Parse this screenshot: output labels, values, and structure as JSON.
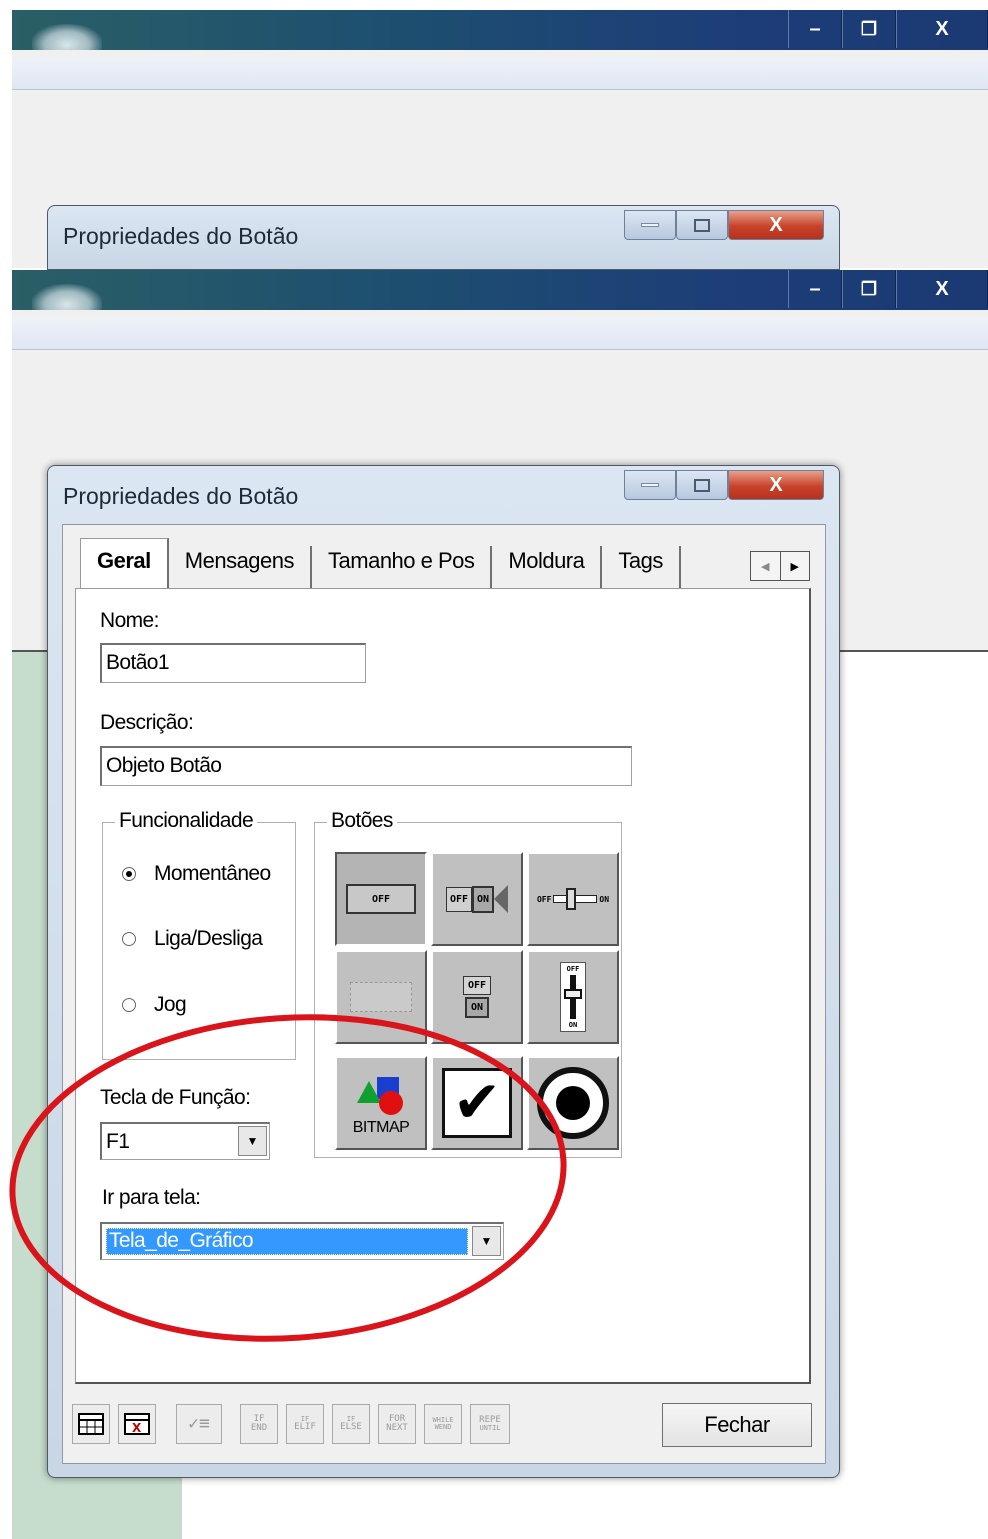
{
  "window_controls": {
    "minimize": "–",
    "maximize": "❐",
    "close": "X"
  },
  "dialog": {
    "title": "Propriedades do Botão",
    "controls": {
      "minimize": "▬",
      "maximize": "▣",
      "close": "X"
    }
  },
  "tabs": [
    {
      "label": "Geral",
      "active": true
    },
    {
      "label": "Mensagens"
    },
    {
      "label": "Tamanho e Pos"
    },
    {
      "label": "Moldura"
    },
    {
      "label": "Tags"
    }
  ],
  "tab_scroll": {
    "left": "◀",
    "right": "▶"
  },
  "form": {
    "name_label": "Nome:",
    "name_value": "Botão1",
    "description_label": "Descrição:",
    "description_value": "Objeto Botão",
    "functionality": {
      "title": "Funcionalidade",
      "options": [
        {
          "label": "Momentâneo",
          "selected": true
        },
        {
          "label": "Liga/Desliga",
          "selected": false
        },
        {
          "label": "Jog",
          "selected": false
        }
      ]
    },
    "buttons_group": {
      "title": "Botões",
      "styles": [
        {
          "icon": "off-push-button-icon",
          "text": "OFF",
          "selected": true
        },
        {
          "icon": "off-on-rocker-icon",
          "text": "OFF ON"
        },
        {
          "icon": "horizontal-slider-switch-icon",
          "text": "OFF ON"
        },
        {
          "icon": "blank-button-icon",
          "text": ""
        },
        {
          "icon": "vertical-rocker-icon",
          "text": "OFF ON"
        },
        {
          "icon": "vertical-slider-switch-icon",
          "text": "OFF ON"
        },
        {
          "icon": "bitmap-shapes-icon",
          "text": "BITMAP"
        },
        {
          "icon": "checkmark-icon",
          "text": ""
        },
        {
          "icon": "radio-target-icon",
          "text": ""
        }
      ]
    },
    "function_key_label": "Tecla de Função:",
    "function_key_value": "F1",
    "go_to_screen_label": "Ir para tela:",
    "go_to_screen_value": "Tela_de_Gráfico"
  },
  "toolbar": {
    "keywords": [
      [
        "IF",
        "END"
      ],
      [
        "IF",
        "ELIF"
      ],
      [
        "IF",
        "ELSE"
      ],
      [
        "FOR",
        "NEXT"
      ],
      [
        "WHILE",
        "WEND"
      ],
      [
        "REPE",
        "UNTIL"
      ]
    ],
    "close_label": "Fechar"
  },
  "colors": {
    "highlight": "#3399ff",
    "annotation_circle": "#d9151b",
    "titlebar": "#1d3f78"
  }
}
